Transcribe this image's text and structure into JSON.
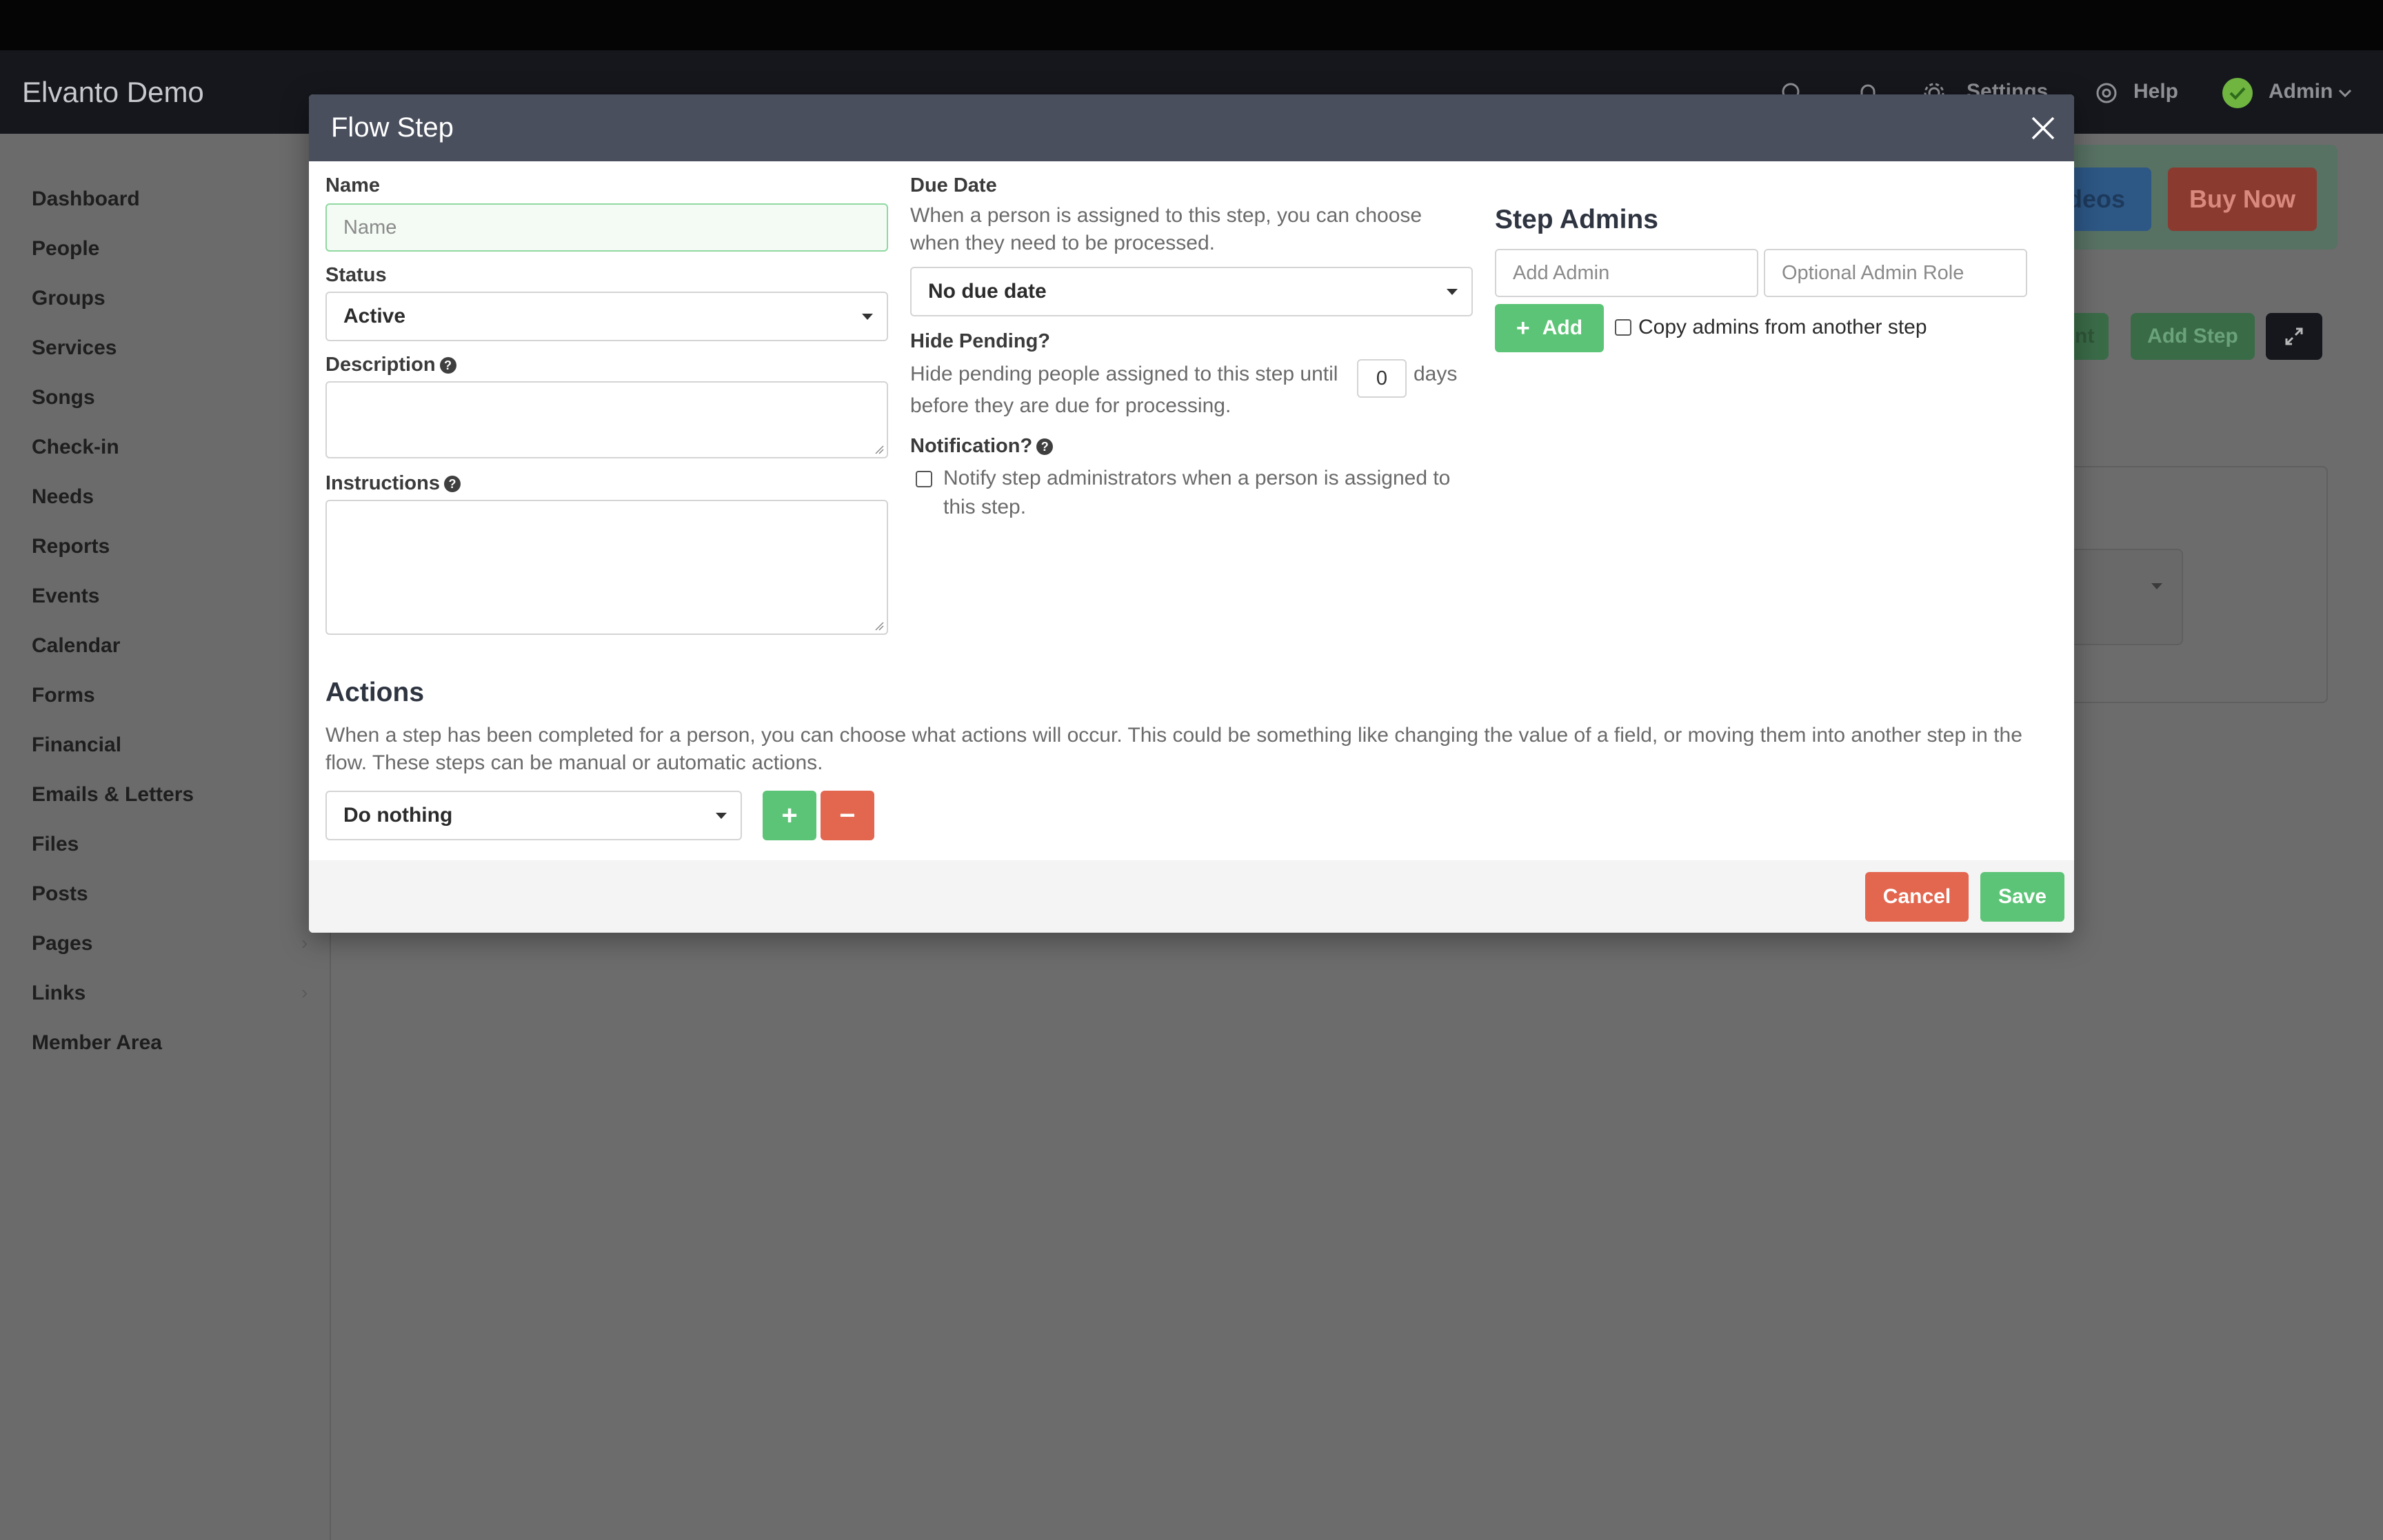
{
  "app": {
    "title": "Elvanto Demo"
  },
  "header": {
    "settings_label": "Settings",
    "help_label": "Help",
    "user_label": "Admin"
  },
  "sidebar": {
    "items": [
      {
        "label": "Dashboard"
      },
      {
        "label": "People"
      },
      {
        "label": "Groups"
      },
      {
        "label": "Services"
      },
      {
        "label": "Songs"
      },
      {
        "label": "Check-in"
      },
      {
        "label": "Needs"
      },
      {
        "label": "Reports"
      },
      {
        "label": "Events"
      },
      {
        "label": "Calendar"
      },
      {
        "label": "Forms"
      },
      {
        "label": "Financial"
      },
      {
        "label": "Emails & Letters"
      },
      {
        "label": "Files"
      },
      {
        "label": "Posts"
      },
      {
        "label": "Pages"
      },
      {
        "label": "Links"
      },
      {
        "label": "Member Area"
      }
    ]
  },
  "background": {
    "videos_label": "deos",
    "buy_now_label": "Buy Now",
    "print_label": "int",
    "add_step_label": "Add Step",
    "select_fragment": "t"
  },
  "modal": {
    "title": "Flow Step",
    "name": {
      "label": "Name",
      "placeholder": "Name",
      "value": ""
    },
    "status": {
      "label": "Status",
      "value": "Active"
    },
    "description": {
      "label": "Description"
    },
    "instructions": {
      "label": "Instructions"
    },
    "due_date": {
      "label": "Due Date",
      "help": "When a person is assigned to this step, you can choose when they need to be processed.",
      "value": "No due date"
    },
    "hide_pending": {
      "label": "Hide Pending?",
      "text_before": "Hide pending people assigned to this step until",
      "days_value": "0",
      "text_after": "days",
      "text_line2": "before they are due for processing."
    },
    "notification": {
      "label": "Notification?",
      "checkbox_text": "Notify step administrators when a person is assigned to this step.",
      "checked": false
    },
    "step_admins": {
      "title": "Step Admins",
      "admin_placeholder": "Add Admin",
      "role_placeholder": "Optional Admin Role",
      "add_label": "Add",
      "copy_label": "Copy admins from another step",
      "copy_checked": false
    },
    "actions": {
      "title": "Actions",
      "help": "When a step has been completed for a person, you can choose what actions will occur. This could be something like changing the value of a field, or moving them into another step in the flow. These steps can be manual or automatic actions.",
      "value": "Do nothing"
    },
    "footer": {
      "cancel_label": "Cancel",
      "save_label": "Save"
    }
  },
  "colors": {
    "accent_green": "#5cc476",
    "accent_red": "#e3664f",
    "modal_header": "#4a4f5e"
  }
}
